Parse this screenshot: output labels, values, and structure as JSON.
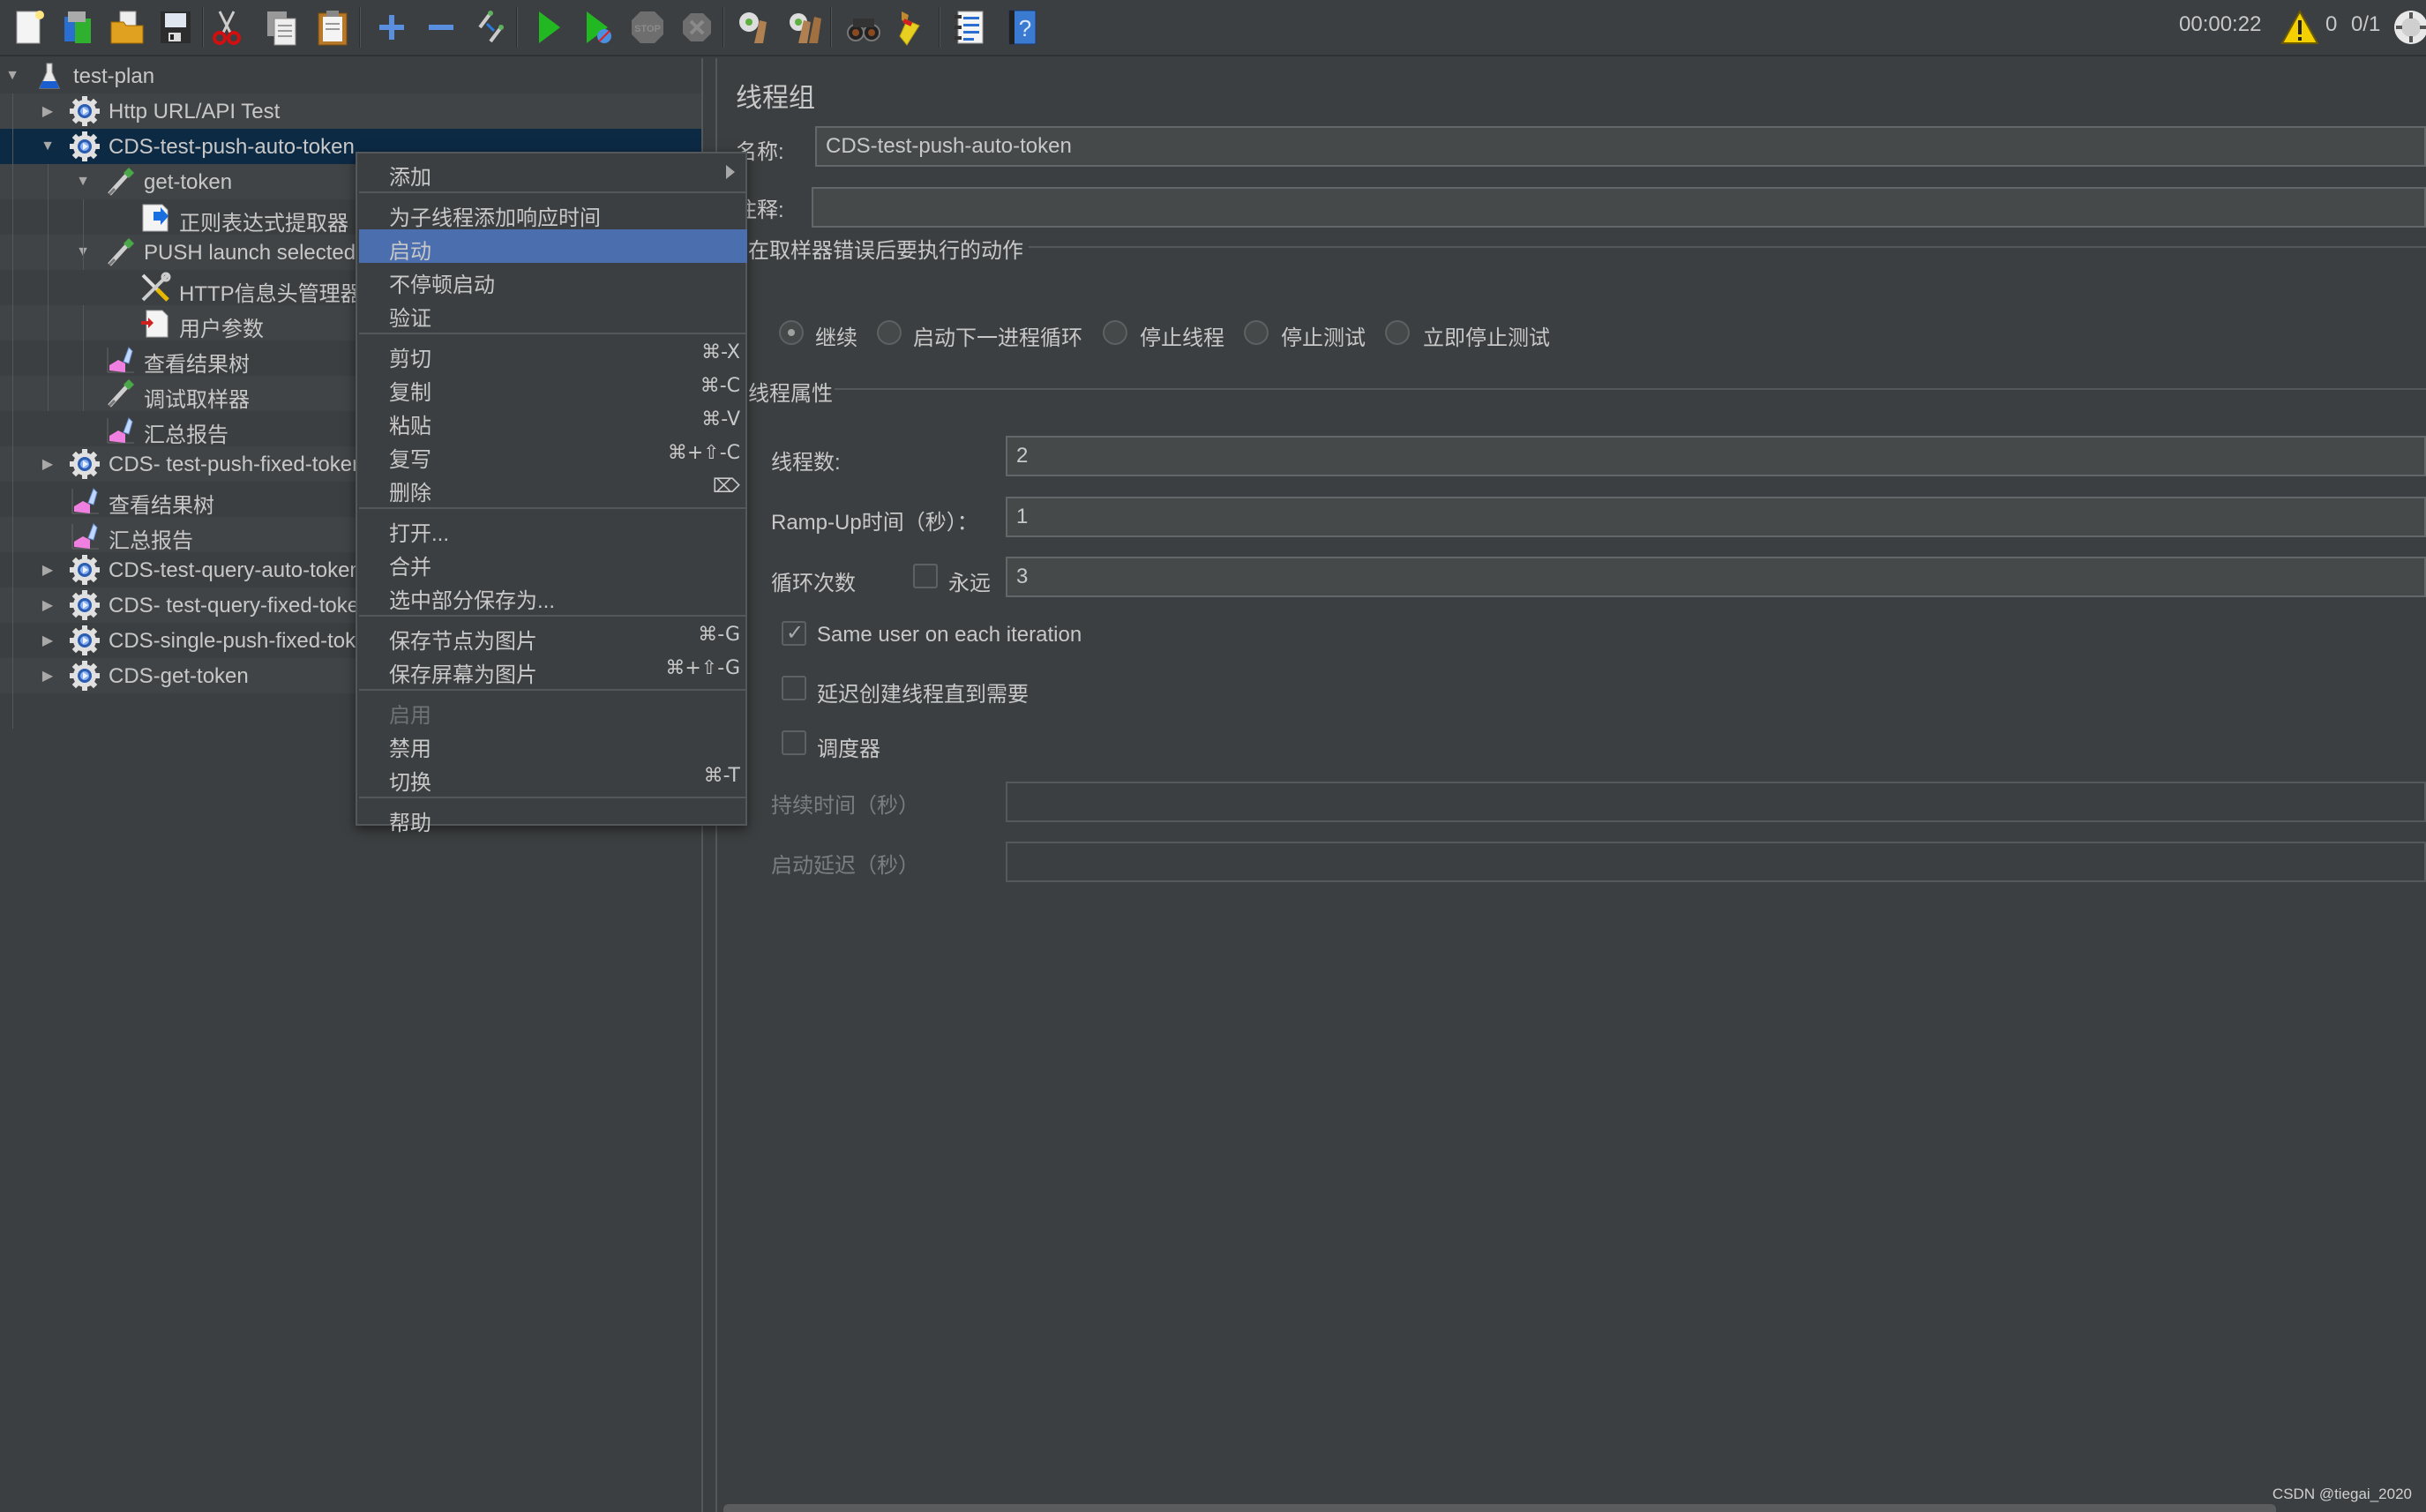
{
  "toolbar": {
    "icons": [
      {
        "name": "new-icon"
      },
      {
        "name": "templates-icon"
      },
      {
        "name": "open-icon"
      },
      {
        "name": "save-icon"
      },
      {
        "name": "cut-icon"
      },
      {
        "name": "copy-icon"
      },
      {
        "name": "paste-icon"
      },
      {
        "name": "expand-icon"
      },
      {
        "name": "collapse-icon"
      },
      {
        "name": "toggle-icon"
      },
      {
        "name": "start-icon"
      },
      {
        "name": "start-no-pause-icon"
      },
      {
        "name": "stop-icon"
      },
      {
        "name": "shutdown-icon"
      },
      {
        "name": "clear-icon"
      },
      {
        "name": "clear-all-icon"
      },
      {
        "name": "search-icon"
      },
      {
        "name": "reset-search-icon"
      },
      {
        "name": "function-helper-icon"
      },
      {
        "name": "help-icon"
      }
    ],
    "elapsed_time": "00:00:22",
    "warning_count": "0",
    "active_threads": "0/1"
  },
  "tree": {
    "items": [
      {
        "label": "test-plan",
        "icon": "test-plan-icon",
        "level": 0,
        "toggle": "expanded"
      },
      {
        "label": "Http URL/API Test",
        "icon": "thread-group-icon",
        "level": 1,
        "toggle": "collapsed"
      },
      {
        "label": "CDS-test-push-auto-token",
        "icon": "thread-group-icon",
        "level": 1,
        "toggle": "expanded",
        "selected": true
      },
      {
        "label": "get-token",
        "icon": "sampler-icon",
        "level": 2,
        "toggle": "expanded"
      },
      {
        "label": "正则表达式提取器",
        "icon": "extractor-icon",
        "level": 3,
        "toggle": "none"
      },
      {
        "label": "PUSH launch selected",
        "icon": "sampler-icon",
        "level": 2,
        "toggle": "expanded"
      },
      {
        "label": "HTTP信息头管理器",
        "icon": "header-manager-icon",
        "level": 3,
        "toggle": "none"
      },
      {
        "label": "用户参数",
        "icon": "user-params-icon",
        "level": 3,
        "toggle": "none"
      },
      {
        "label": "查看结果树",
        "icon": "listener-icon",
        "level": 2,
        "toggle": "none"
      },
      {
        "label": "调试取样器",
        "icon": "sampler-icon",
        "level": 2,
        "toggle": "none"
      },
      {
        "label": "汇总报告",
        "icon": "listener-icon",
        "level": 2,
        "toggle": "none"
      },
      {
        "label": "CDS- test-push-fixed-token",
        "icon": "thread-group-icon",
        "level": 1,
        "toggle": "collapsed"
      },
      {
        "label": "查看结果树",
        "icon": "listener-icon",
        "level": 1,
        "toggle": "none"
      },
      {
        "label": "汇总报告",
        "icon": "listener-icon",
        "level": 1,
        "toggle": "none"
      },
      {
        "label": "CDS-test-query-auto-token",
        "icon": "thread-group-icon",
        "level": 1,
        "toggle": "collapsed"
      },
      {
        "label": "CDS- test-query-fixed-token",
        "icon": "thread-group-icon",
        "level": 1,
        "toggle": "collapsed"
      },
      {
        "label": "CDS-single-push-fixed-token",
        "icon": "thread-group-icon",
        "level": 1,
        "toggle": "collapsed"
      },
      {
        "label": "CDS-get-token",
        "icon": "thread-group-icon",
        "level": 1,
        "toggle": "collapsed"
      }
    ]
  },
  "context_menu": {
    "items": [
      {
        "label": "添加",
        "shortcut": "",
        "submenu": true
      },
      {
        "separator": true
      },
      {
        "label": "为子线程添加响应时间",
        "shortcut": ""
      },
      {
        "label": "启动",
        "shortcut": "",
        "highlight": true
      },
      {
        "label": "不停顿启动",
        "shortcut": ""
      },
      {
        "label": "验证",
        "shortcut": ""
      },
      {
        "separator": true
      },
      {
        "label": "剪切",
        "shortcut": "⌘-X"
      },
      {
        "label": "复制",
        "shortcut": "⌘-C"
      },
      {
        "label": "粘贴",
        "shortcut": "⌘-V"
      },
      {
        "label": "复写",
        "shortcut": "⌘+⇧-C"
      },
      {
        "label": "删除",
        "shortcut": "⌦"
      },
      {
        "separator": true
      },
      {
        "label": "打开...",
        "shortcut": ""
      },
      {
        "label": "合并",
        "shortcut": ""
      },
      {
        "label": "选中部分保存为...",
        "shortcut": ""
      },
      {
        "separator": true
      },
      {
        "label": "保存节点为图片",
        "shortcut": "⌘-G"
      },
      {
        "label": "保存屏幕为图片",
        "shortcut": "⌘+⇧-G"
      },
      {
        "separator": true
      },
      {
        "label": "启用",
        "shortcut": "",
        "disabled": true
      },
      {
        "label": "禁用",
        "shortcut": ""
      },
      {
        "label": "切换",
        "shortcut": "⌘-T"
      },
      {
        "separator": true
      },
      {
        "label": "帮助",
        "shortcut": ""
      }
    ]
  },
  "panel": {
    "title": "线程组",
    "name_label": "名称:",
    "name_value": "CDS-test-push-auto-token",
    "comment_label": "注释:",
    "comment_value": "",
    "error_section_title": "在取样器错误后要执行的动作",
    "error_actions": [
      {
        "label": "继续",
        "checked": true
      },
      {
        "label": "启动下一进程循环",
        "checked": false
      },
      {
        "label": "停止线程",
        "checked": false
      },
      {
        "label": "停止测试",
        "checked": false
      },
      {
        "label": "立即停止测试",
        "checked": false
      }
    ],
    "thread_props_title": "线程属性",
    "thread_count_label": "线程数:",
    "thread_count_value": "2",
    "rampup_label": "Ramp-Up时间（秒）：",
    "rampup_value": "1",
    "loop_label": "循环次数",
    "forever_label": "永远",
    "forever_checked": false,
    "loop_value": "3",
    "same_user_label": "Same user on each iteration",
    "same_user_checked": true,
    "delay_create_label": "延迟创建线程直到需要",
    "delay_create_checked": false,
    "scheduler_label": "调度器",
    "scheduler_checked": false,
    "duration_label": "持续时间（秒）",
    "duration_value": "",
    "startup_delay_label": "启动延迟（秒）",
    "startup_delay_value": ""
  },
  "watermark": "CSDN @tiegai_2020"
}
